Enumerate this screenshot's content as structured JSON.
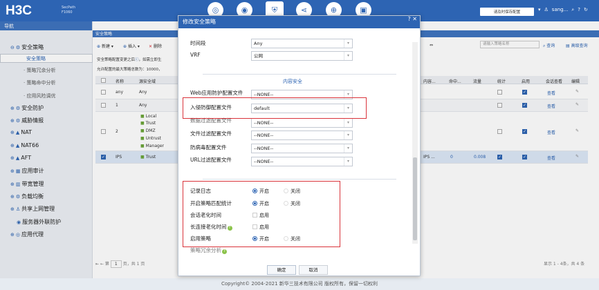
{
  "header": {
    "logo": "H3C",
    "product_line1": "SecPath",
    "product_line2": "F1060",
    "save_label": "请及时保存配置",
    "user_label": "sang...",
    "nav_icons": [
      "dashboard-icon",
      "monitor-icon",
      "policy-icon",
      "network-icon",
      "globe-icon",
      "system-icon"
    ]
  },
  "sidebar": {
    "title": "导航",
    "items": [
      {
        "label": "安全策略",
        "level": 0
      },
      {
        "label": "安全策略",
        "level": 1,
        "selected": true
      },
      {
        "label": "策略冗余分析",
        "level": 1
      },
      {
        "label": "策略命中分析",
        "level": 1
      },
      {
        "label": "应用风险调优",
        "level": 1
      },
      {
        "label": "安全防护",
        "level": 0
      },
      {
        "label": "威胁情报",
        "level": 0
      },
      {
        "label": "NAT",
        "level": 0
      },
      {
        "label": "NAT66",
        "level": 0
      },
      {
        "label": "AFT",
        "level": 0
      },
      {
        "label": "应用审计",
        "level": 0
      },
      {
        "label": "带宽管理",
        "level": 0
      },
      {
        "label": "负载均衡",
        "level": 0
      },
      {
        "label": "共享上网管理",
        "level": 0
      },
      {
        "label": "服务器外联防护",
        "level": 1
      },
      {
        "label": "应用代理",
        "level": 0
      }
    ]
  },
  "main": {
    "title": "安全策略",
    "toolbar": {
      "new_label": "新建",
      "insert_label": "插入",
      "delete_label": "删除"
    },
    "info1": "安全策略配置变更之后",
    "info1b": "，如需立即生",
    "info2": "允许配置的最大策略总数为：10000，",
    "search_placeholder": "请输入策略名称",
    "query_label": "查询",
    "advanced_label": "高级查询",
    "columns": {
      "name": "名称",
      "src_zone": "源安全域",
      "hits": "内容...",
      "hit_count": "命中...",
      "flow": "流量",
      "stats": "统计",
      "enable": "启用",
      "view": "会话查看",
      "edit": "编辑"
    },
    "rows": [
      {
        "name": "any",
        "src": "Any",
        "view": "查看"
      },
      {
        "name": "1",
        "src": "Any",
        "view": "查看"
      },
      {
        "name": "2",
        "zones": [
          "Local",
          "Trust",
          "DMZ",
          "Untrust",
          "Manager"
        ],
        "view": "查看"
      },
      {
        "name": "IPS",
        "zones": [
          "Trust"
        ],
        "content": "IPS ...",
        "hit": "0",
        "flow": "0.008",
        "view": "查看"
      }
    ],
    "pager": {
      "page_label": "第",
      "page": "1",
      "total_label": "页，共 1 页",
      "summary": "显示 1 - 4条，共 4 条"
    }
  },
  "footer": {
    "text": "Copyright© 2004-2021 新华三技术有限公司 版权所有，保留一切权利"
  },
  "modal": {
    "title": "修改安全策略",
    "fields": {
      "time_range": {
        "label": "时间段",
        "value": "Any"
      },
      "vrf": {
        "label": "VRF",
        "value": "公网"
      }
    },
    "content_security_title": "内容安全",
    "profiles": [
      {
        "label": "Web应用防护配置文件",
        "value": "--NONE--"
      },
      {
        "label": "入侵防御配置文件",
        "value": "default"
      },
      {
        "label": "数据过滤配置文件",
        "value": "--NONE--"
      },
      {
        "label": "文件过滤配置文件",
        "value": "--NONE--"
      },
      {
        "label": "防病毒配置文件",
        "value": "--NONE--"
      },
      {
        "label": "URL过滤配置文件",
        "value": "--NONE--"
      }
    ],
    "options": [
      {
        "label": "记录日志",
        "on": "开启",
        "off": "关闭"
      },
      {
        "label": "开启策略匹配统计",
        "on": "开启",
        "off": "关闭"
      },
      {
        "label": "会话老化时间",
        "check": "启用"
      },
      {
        "label": "长连接老化时间",
        "check": "启用"
      },
      {
        "label": "启用策略",
        "on": "开启",
        "off": "关闭"
      },
      {
        "label": "策略冗余分析"
      }
    ],
    "ok_label": "确定",
    "cancel_label": "取消"
  }
}
